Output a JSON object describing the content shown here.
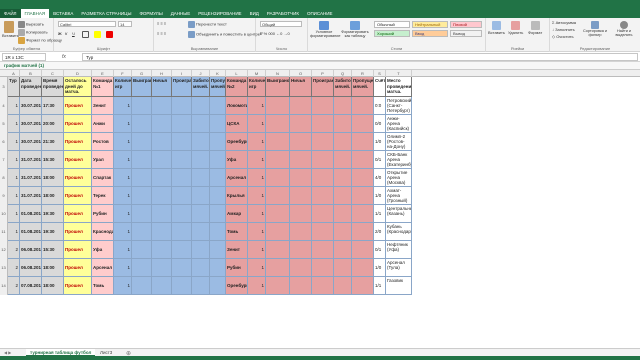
{
  "ribbon_tabs": [
    "ФАЙЛ",
    "ГЛАВНАЯ",
    "ВСТАВКА",
    "РАЗМЕТКА СТРАНИЦЫ",
    "ФОРМУЛЫ",
    "ДАННЫЕ",
    "РЕЦЕНЗИРОВАНИЕ",
    "ВИД",
    "РАЗРАБОТЧИК",
    "ОПИСАНИЕ"
  ],
  "clipboard": {
    "cut": "Вырезать",
    "copy": "Копировать",
    "format": "Формат по образцу",
    "label": "Буфер обмена",
    "paste": "Вставить"
  },
  "font": {
    "name": "Calibri",
    "size": "14",
    "label": "Шрифт"
  },
  "alignment": {
    "wrap": "Перенести текст",
    "merge": "Объединить и поместить в центре",
    "label": "Выравнивание"
  },
  "number": {
    "format": "Общий",
    "label": "Число"
  },
  "styles": {
    "cond_format": "Условное форматирование",
    "as_table": "Форматировать как таблицу",
    "cells": [
      "Обычный",
      "Нейтральный",
      "Плохой",
      "Хороший",
      "Ввод",
      "Вывод"
    ],
    "label": "Стили"
  },
  "cells_group": {
    "insert": "Вставить",
    "delete": "Удалить",
    "format": "Формат",
    "label": "Ячейки"
  },
  "editing": {
    "autosum": "Автосумма",
    "fill": "Заполнить",
    "clear": "Очистить",
    "sort": "Сортировка и фильтр",
    "find": "Найти и выделить",
    "label": "Редактирование"
  },
  "formula_bar": {
    "name_box": "1R x 13C",
    "fx": "fx",
    "value": "Тур"
  },
  "group_title": "график матчей (1)",
  "columns": [
    "A",
    "B",
    "C",
    "D",
    "E",
    "F",
    "G",
    "H",
    "I",
    "J",
    "K",
    "L",
    "M",
    "N",
    "O",
    "P",
    "Q",
    "R",
    "S",
    "T"
  ],
  "headers": [
    "Тур",
    "Дата проведения",
    "Время проведения",
    "Осталось дней до матча.",
    "Команда №1",
    "Количество игр",
    "Выиграно",
    "Ничья",
    "Проиграно",
    "Забито мячей.",
    "Пропущено мячей.",
    "Команда №2",
    "Количество игр",
    "Выиграно",
    "Ничья",
    "Проиграно",
    "Забито мячей.",
    "Пропущено мячей.",
    "Счёт",
    "Место проведения матча."
  ],
  "rows": [
    {
      "num": "4",
      "tour": "1",
      "date": "30.07.2016",
      "time": "17:30",
      "status": "Прошел",
      "t1": "Зенит",
      "g1": "1",
      "t2": "Локомотив",
      "g2": "1",
      "score": "0:0",
      "place": "Петровский (Санкт-Петербург)"
    },
    {
      "num": "5",
      "tour": "1",
      "date": "30.07.2016",
      "time": "20:00",
      "status": "Прошел",
      "t1": "Анжи",
      "g1": "1",
      "t2": "ЦСКА",
      "g2": "1",
      "score": "0/0",
      "place": "Анжи-Арена (Каспийск)"
    },
    {
      "num": "6",
      "tour": "1",
      "date": "30.07.2016",
      "time": "21:30",
      "status": "Прошел",
      "t1": "Ростов",
      "g1": "1",
      "t2": "Оренбург",
      "g2": "1",
      "score": "1/0",
      "place": "Олимп-2 (Ростов-на-Дону)"
    },
    {
      "num": "7",
      "tour": "1",
      "date": "31.07.2016",
      "time": "15:30",
      "status": "Прошел",
      "t1": "Урал",
      "g1": "1",
      "t2": "Уфа",
      "g2": "1",
      "score": "0/1",
      "place": "СКБ-Банк Арена (Екатеринбург)"
    },
    {
      "num": "8",
      "tour": "1",
      "date": "31.07.2016",
      "time": "18:00",
      "status": "Прошел",
      "t1": "Спартак",
      "g1": "1",
      "t2": "Арсенал",
      "g2": "1",
      "score": "4/0",
      "place": "Открытие Арена (Москва)"
    },
    {
      "num": "9",
      "tour": "1",
      "date": "31.07.2016",
      "time": "18:00",
      "status": "Прошел",
      "t1": "Терек",
      "g1": "1",
      "t2": "Крылья Советов",
      "g2": "1",
      "score": "1/0",
      "place": "Ахмат-Арена (Грозный)"
    },
    {
      "num": "10",
      "tour": "1",
      "date": "01.08.2016",
      "time": "19:30",
      "status": "Прошел",
      "t1": "Рубин",
      "g1": "1",
      "t2": "Амкар",
      "g2": "1",
      "score": "1/1",
      "place": "Центральный (Казань)"
    },
    {
      "num": "11",
      "tour": "1",
      "date": "01.08.2016",
      "time": "19:30",
      "status": "Прошел",
      "t1": "Краснодар",
      "g1": "1",
      "t2": "Томь",
      "g2": "1",
      "score": "2/0",
      "place": "Кубань (Краснодар)"
    },
    {
      "num": "12",
      "tour": "2",
      "date": "06.08.2016",
      "time": "15:30",
      "status": "Прошел",
      "t1": "Уфа",
      "g1": "1",
      "t2": "Зенит",
      "g2": "1",
      "score": "0/1",
      "place": "Нефтяник (Уфа)"
    },
    {
      "num": "13",
      "tour": "2",
      "date": "06.08.2016",
      "time": "18:00",
      "status": "Прошел",
      "t1": "Арсенал",
      "g1": "1",
      "t2": "Рубин",
      "g2": "1",
      "score": "1/0",
      "place": "Арсенал (Тула)"
    },
    {
      "num": "14",
      "tour": "2",
      "date": "07.08.2016",
      "time": "18:00",
      "status": "Прошел",
      "t1": "Томь",
      "g1": "1",
      "t2": "Оренбург",
      "g2": "1",
      "score": "1/1",
      "place": "Газовик"
    }
  ],
  "sheet_tabs": [
    "турнирная таблица футбол",
    "Лист3"
  ],
  "colors": {
    "green": "#217346",
    "gray": "#d9d9d9",
    "yellow": "#ffff99",
    "pink": "#ffcccc",
    "blue": "#9bbbe3",
    "red": "#e6a0a0",
    "white": "#ffffff"
  }
}
